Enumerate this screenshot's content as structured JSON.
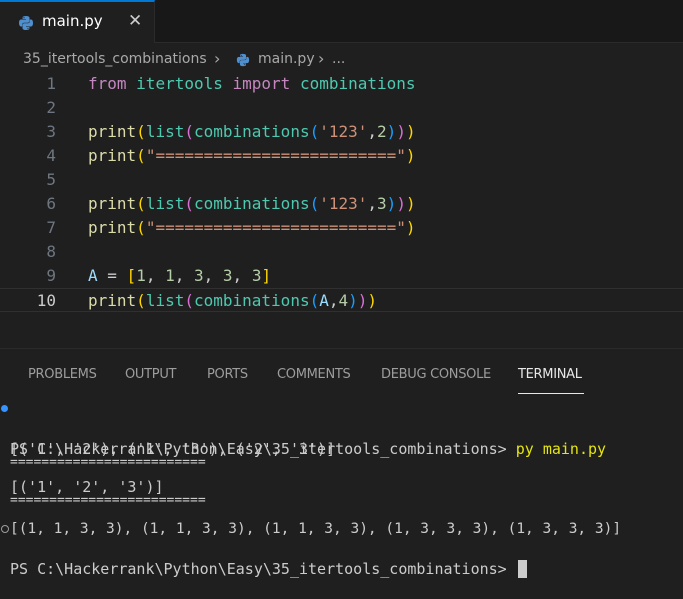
{
  "tab": {
    "label": "main.py",
    "close": "✕"
  },
  "breadcrumb": {
    "folder": "35_itertools_combinations",
    "sep": "›",
    "file": "main.py",
    "sep2": "›",
    "more": "..."
  },
  "editor": {
    "line_numbers": [
      "1",
      "2",
      "3",
      "4",
      "5",
      "6",
      "7",
      "8",
      "9",
      "10"
    ],
    "lines": [
      [
        {
          "t": "from",
          "c": "kw-ctl"
        },
        {
          "t": " ",
          "c": "plain"
        },
        {
          "t": "itertools",
          "c": "type"
        },
        {
          "t": " ",
          "c": "plain"
        },
        {
          "t": "import",
          "c": "kw-ctl"
        },
        {
          "t": " ",
          "c": "plain"
        },
        {
          "t": "combinations",
          "c": "type"
        }
      ],
      [],
      [
        {
          "t": "print",
          "c": "fn"
        },
        {
          "t": "(",
          "c": "b1"
        },
        {
          "t": "list",
          "c": "type"
        },
        {
          "t": "(",
          "c": "b2"
        },
        {
          "t": "combinations",
          "c": "type"
        },
        {
          "t": "(",
          "c": "b3"
        },
        {
          "t": "'123'",
          "c": "str"
        },
        {
          "t": ",",
          "c": "plain"
        },
        {
          "t": "2",
          "c": "num"
        },
        {
          "t": ")",
          "c": "b3"
        },
        {
          "t": ")",
          "c": "b2"
        },
        {
          "t": ")",
          "c": "b1"
        }
      ],
      [
        {
          "t": "print",
          "c": "fn"
        },
        {
          "t": "(",
          "c": "b1"
        },
        {
          "t": "\"=========================\"",
          "c": "str"
        },
        {
          "t": ")",
          "c": "b1"
        }
      ],
      [],
      [
        {
          "t": "print",
          "c": "fn"
        },
        {
          "t": "(",
          "c": "b1"
        },
        {
          "t": "list",
          "c": "type"
        },
        {
          "t": "(",
          "c": "b2"
        },
        {
          "t": "combinations",
          "c": "type"
        },
        {
          "t": "(",
          "c": "b3"
        },
        {
          "t": "'123'",
          "c": "str"
        },
        {
          "t": ",",
          "c": "plain"
        },
        {
          "t": "3",
          "c": "num"
        },
        {
          "t": ")",
          "c": "b3"
        },
        {
          "t": ")",
          "c": "b2"
        },
        {
          "t": ")",
          "c": "b1"
        }
      ],
      [
        {
          "t": "print",
          "c": "fn"
        },
        {
          "t": "(",
          "c": "b1"
        },
        {
          "t": "\"=========================\"",
          "c": "str"
        },
        {
          "t": ")",
          "c": "b1"
        }
      ],
      [],
      [
        {
          "t": "A",
          "c": "var"
        },
        {
          "t": " = ",
          "c": "plain"
        },
        {
          "t": "[",
          "c": "b1"
        },
        {
          "t": "1",
          "c": "num"
        },
        {
          "t": ", ",
          "c": "plain"
        },
        {
          "t": "1",
          "c": "num"
        },
        {
          "t": ", ",
          "c": "plain"
        },
        {
          "t": "3",
          "c": "num"
        },
        {
          "t": ", ",
          "c": "plain"
        },
        {
          "t": "3",
          "c": "num"
        },
        {
          "t": ", ",
          "c": "plain"
        },
        {
          "t": "3",
          "c": "num"
        },
        {
          "t": "]",
          "c": "b1"
        }
      ],
      [
        {
          "t": "print",
          "c": "fn"
        },
        {
          "t": "(",
          "c": "b1"
        },
        {
          "t": "list",
          "c": "type"
        },
        {
          "t": "(",
          "c": "b2"
        },
        {
          "t": "combinations",
          "c": "type"
        },
        {
          "t": "(",
          "c": "b3"
        },
        {
          "t": "A",
          "c": "var"
        },
        {
          "t": ",",
          "c": "plain"
        },
        {
          "t": "4",
          "c": "num"
        },
        {
          "t": ")",
          "c": "b3"
        },
        {
          "t": ")",
          "c": "b2"
        },
        {
          "t": ")",
          "c": "b1"
        }
      ]
    ],
    "current_line": 10
  },
  "panel": {
    "tabs": [
      "PROBLEMS",
      "OUTPUT",
      "PORTS",
      "COMMENTS",
      "DEBUG CONSOLE",
      "TERMINAL"
    ],
    "active_tab": "TERMINAL"
  },
  "terminal": {
    "prompt1": "PS C:\\Hackerrank\\Python\\Easy\\35_itertools_combinations> ",
    "command1": "py main.py",
    "out1": "[('1', '2'), ('1', '3'), ('2', '3')]",
    "sep1": "=========================",
    "out2": "[('1', '2', '3')]",
    "sep2": "=========================",
    "out3": "[(1, 1, 3, 3), (1, 1, 3, 3), (1, 1, 3, 3), (1, 3, 3, 3), (1, 3, 3, 3)]",
    "prompt2": "PS C:\\Hackerrank\\Python\\Easy\\35_itertools_combinations> "
  },
  "colors": {
    "accent": "#0078d4",
    "terminal_dot": "#3794ff",
    "command": "#e5e510"
  }
}
